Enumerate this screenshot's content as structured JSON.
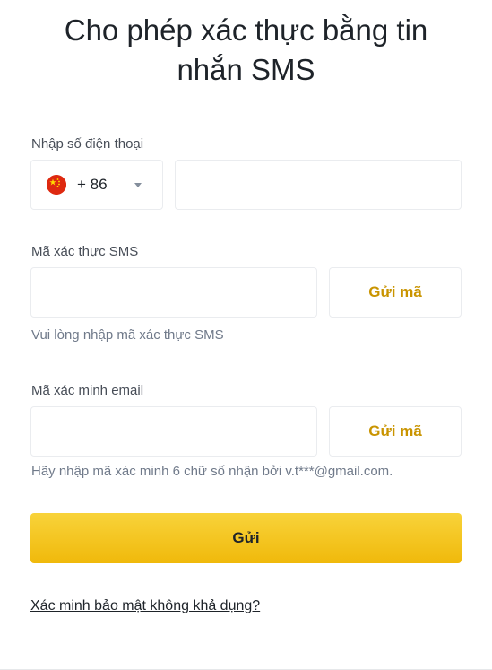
{
  "header": {
    "title_line1": "Cho phép xác thực bằng tin",
    "title_line2": "nhắn SMS"
  },
  "phone": {
    "label": "Nhập số điện thoại",
    "country_flag": "china-flag",
    "dial_code": "+ 86",
    "value": "",
    "placeholder": ""
  },
  "sms_code": {
    "label": "Mã xác thực SMS",
    "value": "",
    "placeholder": "",
    "send_button_label": "Gửi mã",
    "hint": "Vui lòng nhập mã xác thực SMS"
  },
  "email_code": {
    "label": "Mã xác minh email",
    "value": "",
    "placeholder": "",
    "send_button_label": "Gửi mã",
    "hint": "Hãy nhập mã xác minh 6 chữ số nhận bởi v.t***@gmail.com."
  },
  "submit": {
    "label": "Gửi"
  },
  "footer": {
    "link_text": "Xác minh bảo mật không khả dụng?"
  },
  "colors": {
    "accent_yellow": "#f0b90b",
    "send_button_text": "#c99400",
    "text_primary": "#1e2329",
    "text_secondary": "#707a8a",
    "border": "#eaecef"
  }
}
